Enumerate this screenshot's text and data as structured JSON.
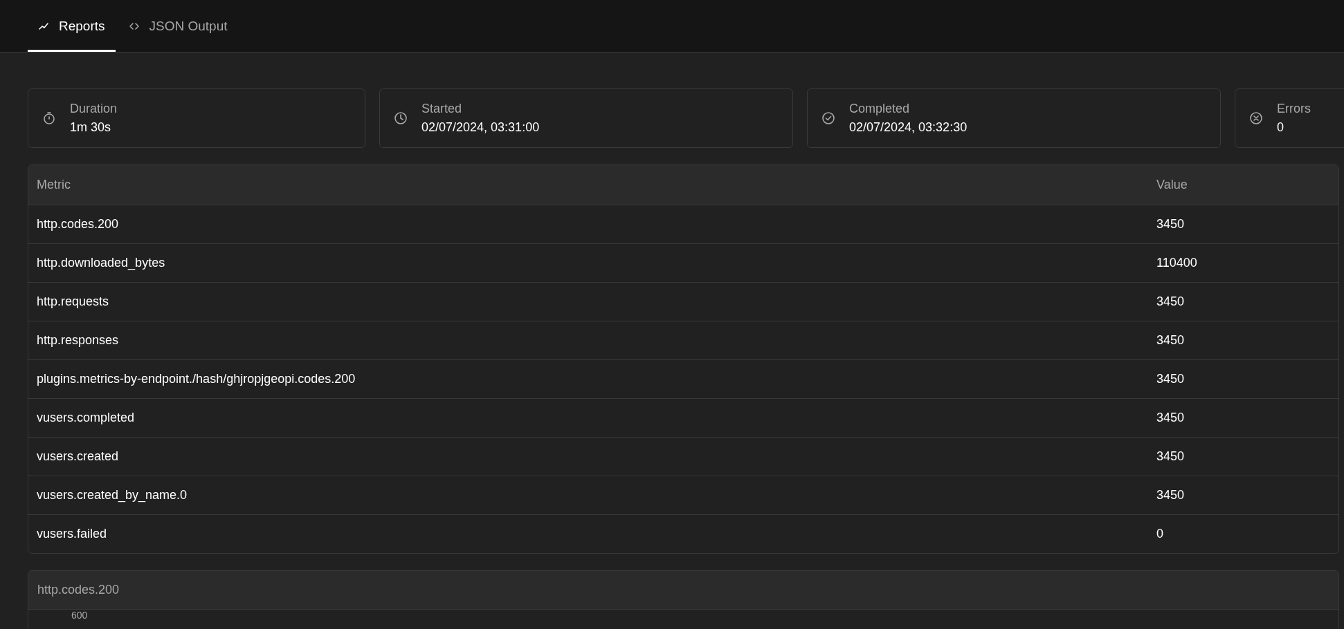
{
  "tabs": [
    {
      "label": "Reports",
      "kind": "chart",
      "selected": true
    },
    {
      "label": "JSON Output",
      "kind": "code",
      "selected": false
    }
  ],
  "summary": [
    {
      "label": "Duration",
      "value": "1m 30s",
      "kind": "timer"
    },
    {
      "label": "Started",
      "value": "02/07/2024, 03:31:00",
      "kind": "clock"
    },
    {
      "label": "Completed",
      "value": "02/07/2024, 03:32:30",
      "kind": "check"
    },
    {
      "label": "Errors",
      "value": "0",
      "kind": "error"
    }
  ],
  "table": {
    "columns": [
      "Metric",
      "Value"
    ],
    "rows": [
      [
        "http.codes.200",
        "3450"
      ],
      [
        "http.downloaded_bytes",
        "110400"
      ],
      [
        "http.requests",
        "3450"
      ],
      [
        "http.responses",
        "3450"
      ],
      [
        "plugins.metrics-by-endpoint./hash/ghjropjgeopi.codes.200",
        "3450"
      ],
      [
        "vusers.completed",
        "3450"
      ],
      [
        "vusers.created",
        "3450"
      ],
      [
        "vusers.created_by_name.0",
        "3450"
      ],
      [
        "vusers.failed",
        "0"
      ]
    ]
  },
  "chart_panel": {
    "title": "http.codes.200",
    "y_tick": "600"
  }
}
